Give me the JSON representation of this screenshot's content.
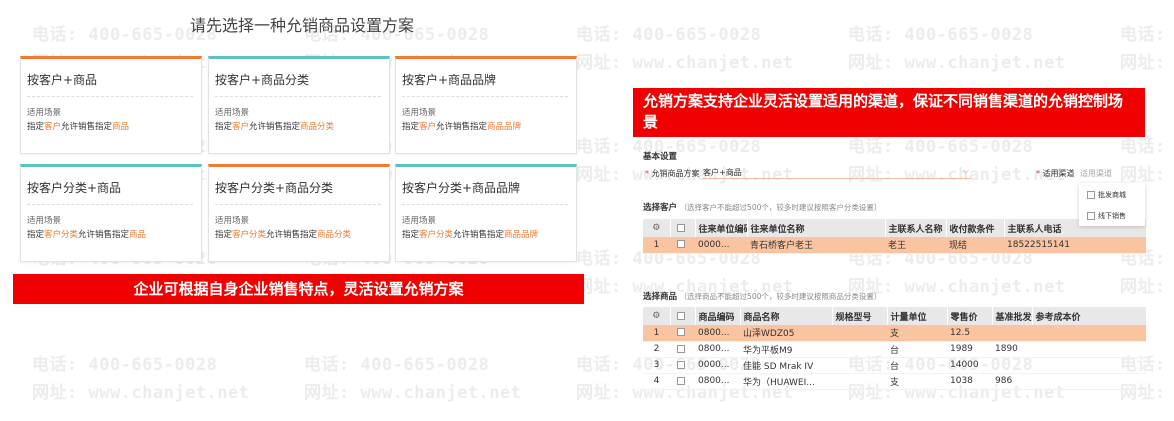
{
  "watermark": {
    "phone": "电话: 400-665-0028",
    "site": "网址: www.chanjet.net"
  },
  "left": {
    "title": "请先选择一种允销商品设置方案",
    "scenario_label": "适用场景",
    "cards": [
      {
        "title": "按客户+商品",
        "accent": "#f07a30",
        "desc": [
          {
            "t": "指定",
            "h": false
          },
          {
            "t": "客户",
            "h": true
          },
          {
            "t": "允许销售指定",
            "h": false
          },
          {
            "t": "商品",
            "h": true
          }
        ]
      },
      {
        "title": "按客户+商品分类",
        "accent": "#5bc4c0",
        "desc": [
          {
            "t": "指定",
            "h": false
          },
          {
            "t": "客户",
            "h": true
          },
          {
            "t": "允许销售指定",
            "h": false
          },
          {
            "t": "商品分类",
            "h": true
          }
        ]
      },
      {
        "title": "按客户+商品品牌",
        "accent": "#f07a30",
        "desc": [
          {
            "t": "指定",
            "h": false
          },
          {
            "t": "客户",
            "h": true
          },
          {
            "t": "允许销售指定",
            "h": false
          },
          {
            "t": "商品品牌",
            "h": true
          }
        ]
      },
      {
        "title": "按客户分类+商品",
        "accent": "#5bc4c0",
        "desc": [
          {
            "t": "指定",
            "h": false
          },
          {
            "t": "客户分类",
            "h": true
          },
          {
            "t": "允许销售指定",
            "h": false
          },
          {
            "t": "商品",
            "h": true
          }
        ]
      },
      {
        "title": "按客户分类+商品分类",
        "accent": "#f07a30",
        "desc": [
          {
            "t": "指定",
            "h": false
          },
          {
            "t": "客户分类",
            "h": true
          },
          {
            "t": "允许销售指定",
            "h": false
          },
          {
            "t": "商品分类",
            "h": true
          }
        ]
      },
      {
        "title": "按客户分类+商品品牌",
        "accent": "#5bc4c0",
        "desc": [
          {
            "t": "指定",
            "h": false
          },
          {
            "t": "客户分类",
            "h": true
          },
          {
            "t": "允许销售指定",
            "h": false
          },
          {
            "t": "商品品牌",
            "h": true
          }
        ]
      }
    ],
    "banner": "企业可根据自身企业销售特点，灵活设置允销方案"
  },
  "right": {
    "banner": "允销方案支持企业灵活设置适用的渠道，保证不同销售渠道的允销控制场景",
    "basic_settings": "基本设置",
    "scheme_label": "允销商品方案",
    "scheme_value": "客户+商品",
    "channel_label": "适用渠道",
    "channel_placeholder": "适用渠道",
    "channel_options": [
      "批发商城",
      "线下销售"
    ],
    "customer_section": {
      "title": "选择客户",
      "note": "（选择客户不能超过500个，较多时建议按照客户分类设置）"
    },
    "customer_headers": [
      "",
      "",
      "往来单位编码",
      "往来单位名称",
      "主联系人名称",
      "收付款条件",
      "主联系人电话"
    ],
    "customer_rows": [
      {
        "idx": "1",
        "code": "0000...",
        "name": "青石桥客户老王",
        "contact": "老王",
        "terms": "现结",
        "phone": "18522515141"
      }
    ],
    "product_section": {
      "title": "选择商品",
      "note": "（选择商品不能超过500个，较多时建议按照商品分类设置）"
    },
    "product_headers": [
      "",
      "",
      "商品编码",
      "商品名称",
      "规格型号",
      "计量单位",
      "零售价",
      "基准批发价",
      "参考成本价"
    ],
    "product_rows": [
      {
        "idx": "1",
        "code": "0800...",
        "name": "山泽WDZ05",
        "spec": "",
        "unit": "支",
        "retail": "12.5",
        "wholesale": "",
        "cost": ""
      },
      {
        "idx": "2",
        "code": "0800...",
        "name": "华为平板M9",
        "spec": "",
        "unit": "台",
        "retail": "1989",
        "wholesale": "1890",
        "cost": ""
      },
      {
        "idx": "3",
        "code": "0000...",
        "name": "佳能 SD Mrak IV",
        "spec": "",
        "unit": "台",
        "retail": "14000",
        "wholesale": "",
        "cost": ""
      },
      {
        "idx": "4",
        "code": "0800...",
        "name": "华为（HUAWEI...",
        "spec": "",
        "unit": "支",
        "retail": "1038",
        "wholesale": "986",
        "cost": ""
      }
    ]
  }
}
